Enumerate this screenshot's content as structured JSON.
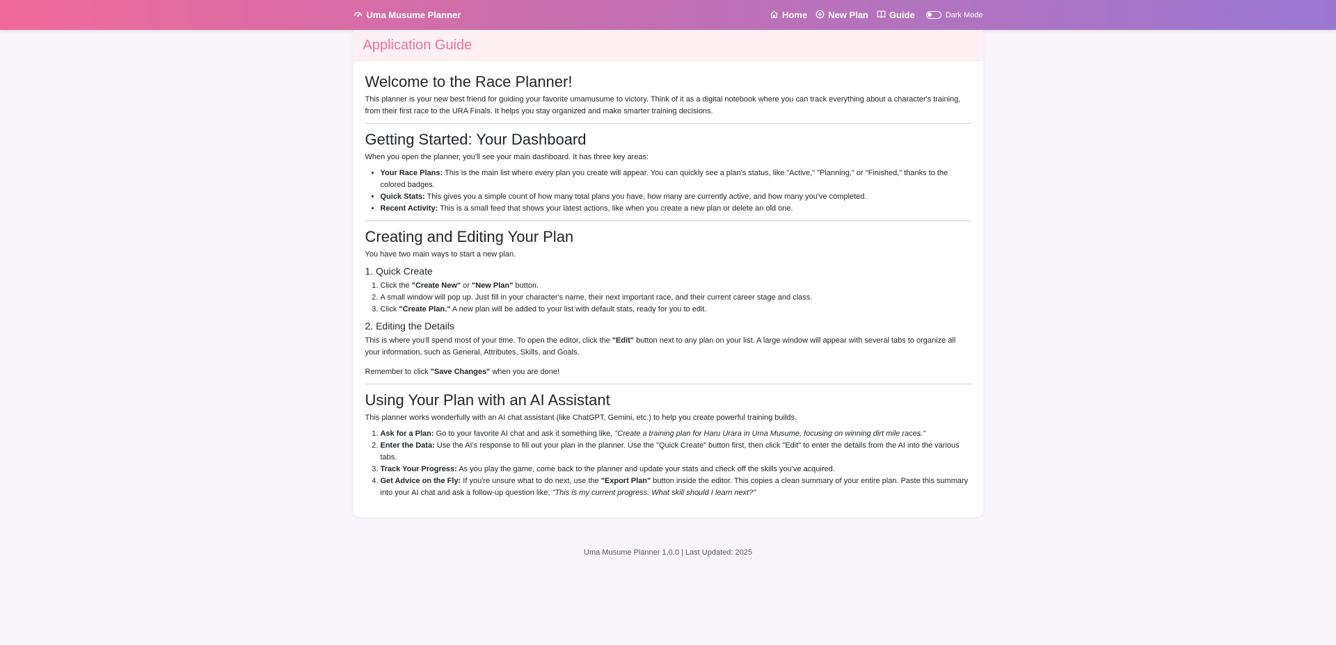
{
  "nav": {
    "brand": "Uma Musume Planner",
    "links": {
      "home": "Home",
      "new_plan": "New Plan",
      "guide": "Guide"
    },
    "dark_mode": "Dark Mode",
    "dark_mode_on": false
  },
  "guide": {
    "header": "Application Guide",
    "welcome": {
      "title": "Welcome to the Race Planner!",
      "text": "This planner is your new best friend for guiding your favorite umamusume to victory. Think of it as a digital notebook where you can track everything about a character's training, from their first race to the URA Finals. It helps you stay organized and make smarter training decisions."
    },
    "dashboard": {
      "title": "Getting Started: Your Dashboard",
      "intro": "When you open the planner, you'll see your main dashboard. It has three key areas:",
      "items": [
        {
          "label": "Your Race Plans:",
          "text": " This is the main list where every plan you create will appear. You can quickly see a plan's status, like \"Active,\" \"Planning,\" or \"Finished,\" thanks to the colored badges."
        },
        {
          "label": "Quick Stats:",
          "text": " This gives you a simple count of how many total plans you have, how many are currently active, and how many you've completed."
        },
        {
          "label": "Recent Activity:",
          "text": " This is a small feed that shows your latest actions, like when you create a new plan or delete an old one."
        }
      ]
    },
    "creating": {
      "title": "Creating and Editing Your Plan",
      "intro": "You have two main ways to start a new plan.",
      "quick_title": "1. Quick Create",
      "quick": {
        "s1_a": "Click the ",
        "s1_b": "\"Create New\"",
        "s1_c": " or ",
        "s1_d": "\"New Plan\"",
        "s1_e": " button.",
        "s2": "A small window will pop up. Just fill in your character's name, their next important race, and their current career stage and class.",
        "s3_a": "Click ",
        "s3_b": "\"Create Plan.\"",
        "s3_c": " A new plan will be added to your list with default stats, ready for you to edit."
      },
      "edit_title": "2. Editing the Details",
      "edit_a": "This is where you'll spend most of your time. To open the editor, click the ",
      "edit_b": "\"Edit\"",
      "edit_c": " button next to any plan on your list. A large window will appear with several tabs to organize all your information, such as General, Attributes, Skills, and Goals.",
      "remember_a": "Remember to click ",
      "remember_b": "\"Save Changes\"",
      "remember_c": " when you are done!"
    },
    "ai": {
      "title": "Using Your Plan with an AI Assistant",
      "intro": "This planner works wonderfully with an AI chat assistant (like ChatGPT, Gemini, etc.) to help you create powerful training builds.",
      "step1_label": "Ask for a Plan:",
      "step1_text": " Go to your favorite AI chat and ask it something like, ",
      "step1_quote": "\"Create a training plan for Haru Urara in Uma Musume, focusing on winning dirt mile races.\"",
      "step2_label": "Enter the Data:",
      "step2_text": " Use the AI's response to fill out your plan in the planner. Use the \"Quick Create\" button first, then click \"Edit\" to enter the details from the AI into the various tabs.",
      "step3_label": "Track Your Progress:",
      "step3_text": " As you play the game, come back to the planner and update your stats and check off the skills you've acquired.",
      "step4_label": "Get Advice on the Fly:",
      "step4_text_a": " If you're unsure what to do next, use the ",
      "step4_btn": "\"Export Plan\"",
      "step4_text_b": " button inside the editor. This copies a clean summary of your entire plan. Paste this summary into your AI chat and ask a follow-up question like, ",
      "step4_quote": "\"This is my current progress. What skill should I learn next?\""
    }
  },
  "footer": "Uma Musume Planner 1.0.0 | Last Updated: 2025"
}
